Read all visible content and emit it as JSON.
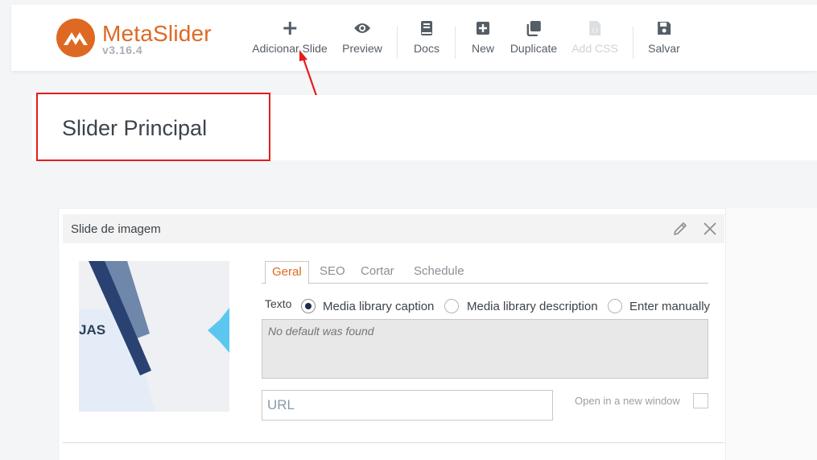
{
  "header": {
    "brand": "MetaSlider",
    "version": "v3.16.4",
    "tools": [
      {
        "label": "Adicionar Slide",
        "icon": "plus-icon",
        "enabled": true
      },
      {
        "label": "Preview",
        "icon": "eye-icon",
        "enabled": true
      },
      {
        "label": "Docs",
        "icon": "book-icon",
        "enabled": true
      },
      {
        "label": "New",
        "icon": "plus-square-icon",
        "enabled": true
      },
      {
        "label": "Duplicate",
        "icon": "copy-icon",
        "enabled": true
      },
      {
        "label": "Add CSS",
        "icon": "css-file-icon",
        "enabled": false
      },
      {
        "label": "Salvar",
        "icon": "save-icon",
        "enabled": true
      }
    ]
  },
  "slider": {
    "title": "Slider Principal"
  },
  "slide": {
    "header_title": "Slide de imagem",
    "thumbnail_text": "JAS",
    "tabs": [
      {
        "label": "Geral",
        "active": true
      },
      {
        "label": "SEO",
        "active": false
      },
      {
        "label": "Cortar",
        "active": false
      },
      {
        "label": "Schedule",
        "active": false
      }
    ],
    "text_label": "Texto",
    "caption_options": [
      {
        "label": "Media library caption",
        "checked": true
      },
      {
        "label": "Media library description",
        "checked": false
      },
      {
        "label": "Enter manually",
        "checked": false
      }
    ],
    "caption_placeholder": "No default was found",
    "url_placeholder": "URL",
    "new_window_label": "Open in a new window",
    "new_window_checked": false
  },
  "colors": {
    "brand": "#dd6923",
    "annotation_red": "#e41d1d",
    "navy": "#1d2d4d"
  }
}
